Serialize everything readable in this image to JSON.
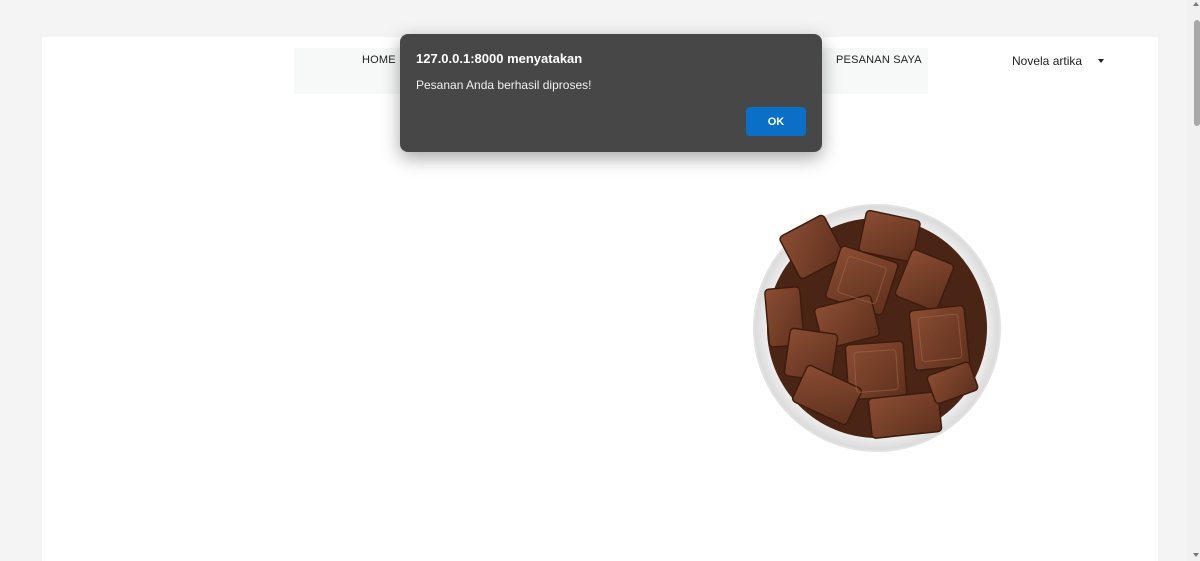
{
  "nav": {
    "home_label": "HOME",
    "orders_label": "PESANAN SAYA",
    "user_name": "Novela artika"
  },
  "dialog": {
    "title": "127.0.0.1:8000 menyatakan",
    "message": "Pesanan Anda berhasil diproses!",
    "ok_label": "OK"
  },
  "colors": {
    "dialog_bg": "#474747",
    "ok_button": "#0a6fc7",
    "chocolate": "#6e3a24"
  },
  "icons": {
    "user_dropdown": "caret-down-icon"
  }
}
